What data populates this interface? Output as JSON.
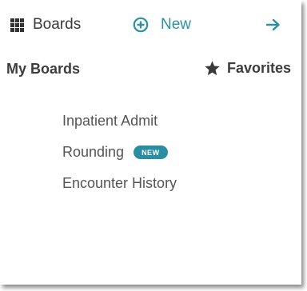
{
  "topbar": {
    "boards_label": "Boards",
    "boards_icon": "grid-icon",
    "new_label": "New",
    "new_icon": "plus-circle-icon",
    "arrow_icon": "arrow-right-icon"
  },
  "sections": {
    "my_boards_label": "My Boards",
    "favorites_label": "Favorites",
    "favorites_icon": "star-icon"
  },
  "boards": [
    {
      "label": "Inpatient Admit"
    },
    {
      "label": "Rounding",
      "badge": "NEW"
    },
    {
      "label": "Encounter History"
    }
  ],
  "colors": {
    "accent": "#2e8fa5",
    "badge_bg": "#2a8ea3",
    "text": "#555555"
  }
}
